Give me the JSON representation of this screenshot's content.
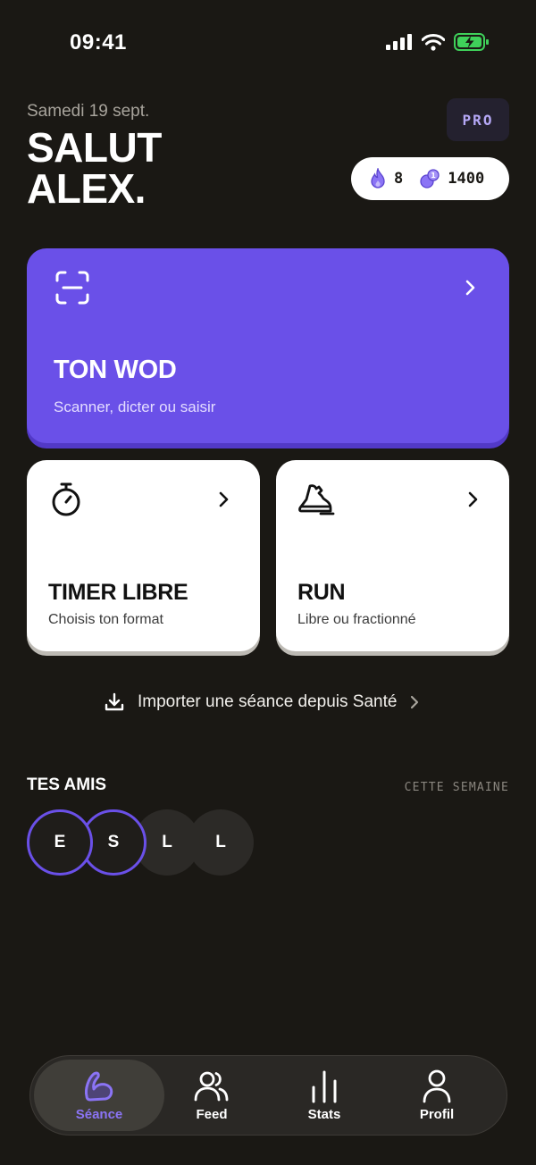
{
  "status_bar": {
    "time": "09:41"
  },
  "header": {
    "date": "Samedi 19 sept.",
    "greeting_line1": "SALUT",
    "greeting_line2": "ALEX.",
    "pro_badge": "PRO",
    "streak_count": "8",
    "coins_count": "1400"
  },
  "cards": {
    "wod": {
      "title": "TON WOD",
      "subtitle": "Scanner, dicter ou saisir"
    },
    "timer": {
      "title": "TIMER LIBRE",
      "subtitle": "Choisis ton format"
    },
    "run": {
      "title": "RUN",
      "subtitle": "Libre ou fractionné"
    }
  },
  "import_link": {
    "label": "Importer une séance depuis Santé"
  },
  "friends": {
    "title": "TES AMIS",
    "period": "CETTE SEMAINE",
    "avatars": [
      {
        "initial": "E",
        "active": true
      },
      {
        "initial": "S",
        "active": true
      },
      {
        "initial": "L",
        "active": false
      },
      {
        "initial": "L",
        "active": false
      }
    ]
  },
  "tabbar": {
    "tabs": [
      {
        "label": "Séance",
        "icon": "flexed-arm-icon",
        "selected": true
      },
      {
        "label": "Feed",
        "icon": "users-icon",
        "selected": false
      },
      {
        "label": "Stats",
        "icon": "bar-stats-icon",
        "selected": false
      },
      {
        "label": "Profil",
        "icon": "person-icon",
        "selected": false
      }
    ]
  },
  "colors": {
    "background": "#1a1814",
    "accent": "#6a50e8",
    "tab_selected": "#8b74f5"
  }
}
